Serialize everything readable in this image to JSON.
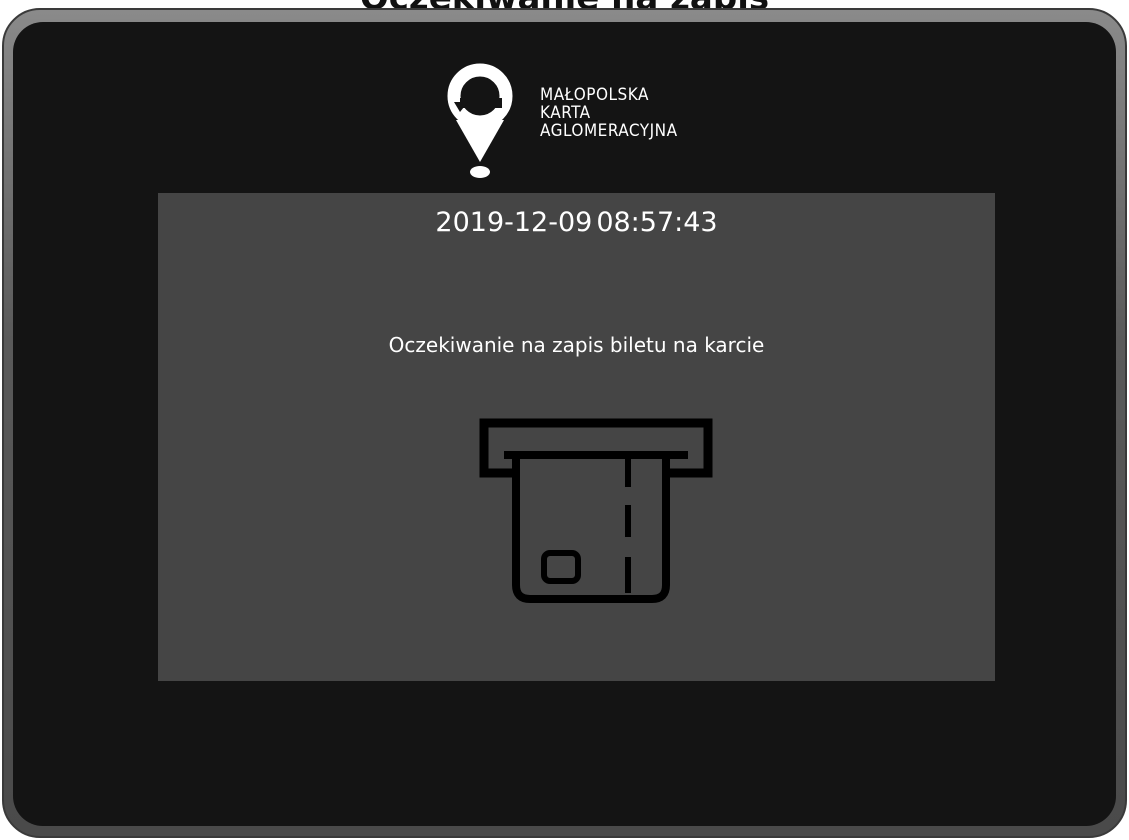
{
  "page": {
    "heading": "Oczekiwanie na zapis"
  },
  "brand": {
    "logo_lines": [
      "MAŁOPOLSKA",
      "KARTA",
      "AGLOMERACYJNA"
    ],
    "logo_icon": "map-pin-icon"
  },
  "screen": {
    "date": "2019-12-09",
    "time": "08:57:43",
    "message": "Oczekiwanie na zapis biletu na karcie",
    "illustration_icon": "card-insert-icon"
  },
  "colors": {
    "bezel": "#5a5a5a",
    "screen_background": "#141414",
    "panel_background": "#454545",
    "text": "#ffffff",
    "icon_stroke": "#000000"
  }
}
